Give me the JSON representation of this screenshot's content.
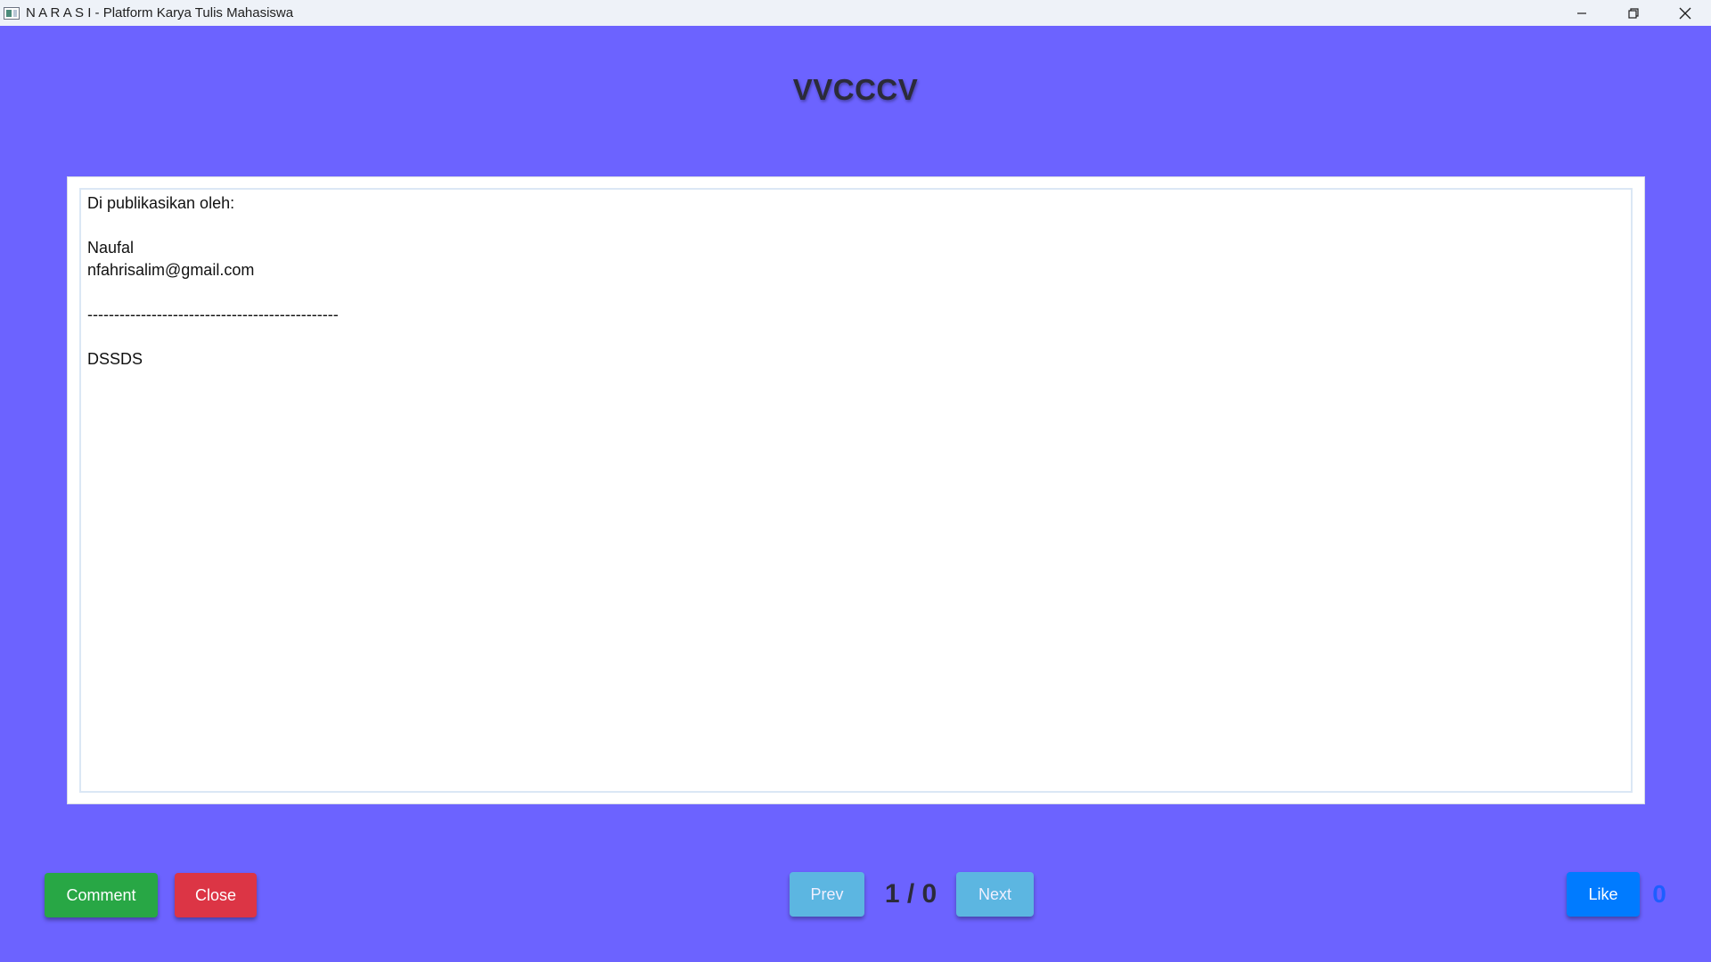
{
  "window": {
    "title": "N A R A S I - Platform Karya Tulis Mahasiswa",
    "controls": [
      "minimize",
      "restore",
      "close"
    ]
  },
  "article": {
    "title": "VVCCCV",
    "content_lines": [
      "Di publikasikan oleh:",
      "",
      "Naufal",
      "nfahrisalim@gmail.com",
      "",
      "-----------------------------------------------",
      "",
      "DSSDS"
    ]
  },
  "actions": {
    "comment_label": "Comment",
    "close_label": "Close",
    "prev_label": "Prev",
    "next_label": "Next",
    "page_indicator": "1 / 0",
    "like_label": "Like",
    "like_count": "0"
  },
  "colors": {
    "background": "#6c63ff",
    "comment": "#28a745",
    "close": "#dc3545",
    "nav": "#5bc0de",
    "like": "#007bff",
    "like_count": "#1e5eff"
  },
  "icons": {
    "app": "app-icon",
    "minimize": "minimize-icon",
    "restore": "restore-icon",
    "close": "close-icon"
  }
}
